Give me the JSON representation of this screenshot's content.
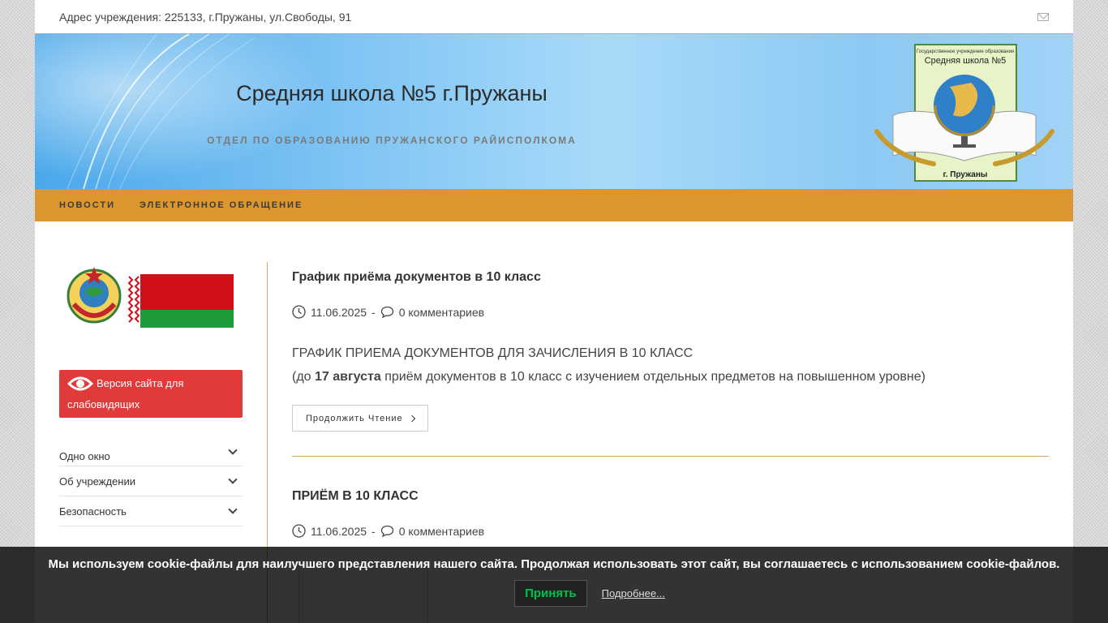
{
  "topbar": {
    "address": "Адрес учреждения: 225133, г.Пружаны, ул.Свободы, 91",
    "mail_icon": "envelope-icon"
  },
  "header": {
    "site_title": "Средняя школа №5 г.Пружаны",
    "site_subtitle": "ОТДЕЛ ПО ОБРАЗОВАНИЮ ПРУЖАНСКОГО РАЙИСПОЛКОМА",
    "emblem": {
      "top_line": "Государственное учреждение образования",
      "name": "Средняя школа №5",
      "city": "г. Пружаны"
    }
  },
  "nav": {
    "items": [
      {
        "label": "НОВОСТИ"
      },
      {
        "label": "ЭЛЕКТРОННОЕ ОБРАЩЕНИЕ"
      }
    ]
  },
  "sidebar": {
    "vision_button": "Версия сайта для слабовидящих",
    "menu": [
      {
        "label": "Одно окно"
      },
      {
        "label": "Об учреждении"
      },
      {
        "label": "Безопасность"
      }
    ]
  },
  "posts": [
    {
      "title": "График приёма документов в 10 класс",
      "date": "11.06.2025",
      "separator": "-",
      "comments": "0 комментариев",
      "excerpt_line1": "ГРАФИК ПРИЕМА ДОКУМЕНТОВ ДЛЯ ЗАЧИСЛЕНИЯ В 10 КЛАСС",
      "excerpt_prefix": "(до ",
      "excerpt_bold": "17 августа",
      "excerpt_suffix": " приём документов в 10 класс с изучением отдельных предметов на повышенном уровне)",
      "read_more": "Продолжить Чтение"
    },
    {
      "title": "ПРИЁМ В 10 КЛАСС",
      "date": "11.06.2025",
      "separator": "-",
      "comments": "0 комментариев"
    }
  ],
  "cookie": {
    "text": "Мы используем cookie-файлы для наилучшего представления нашего сайта. Продолжая использовать этот сайт, вы соглашаетесь с использованием cookie-файлов.",
    "accept": "Принять",
    "more": "Подробнее..."
  },
  "colors": {
    "nav_bg": "#dc9630",
    "accent_line": "#dda560",
    "vision_button": "#e13a3a",
    "accept_text": "#00c14e"
  }
}
